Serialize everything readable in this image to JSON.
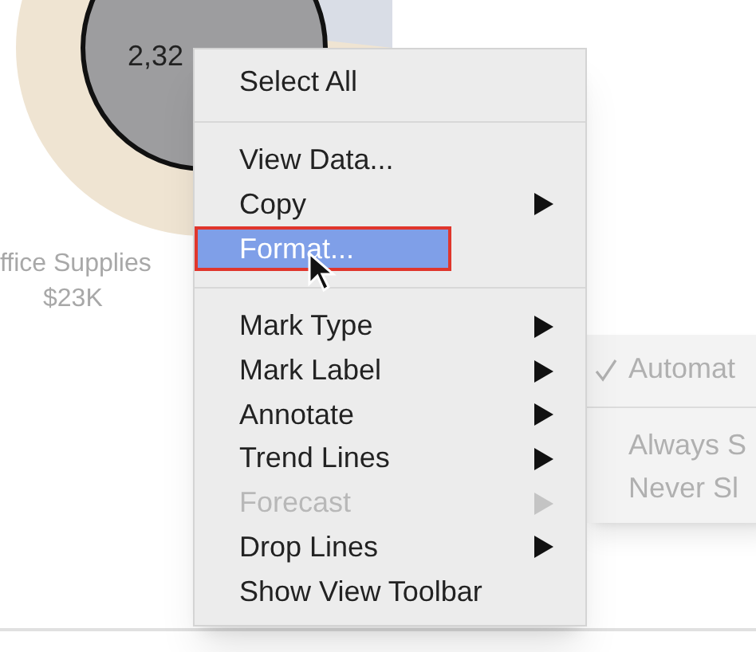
{
  "chart": {
    "center_label": "2,32",
    "segment_label": "ffice Supplies",
    "segment_value": "$23K"
  },
  "context_menu": {
    "items": [
      {
        "kind": "item",
        "label": "Select All",
        "submenu": false,
        "disabled": false,
        "selected": false,
        "outlined": false
      },
      {
        "kind": "separator"
      },
      {
        "kind": "item",
        "label": "View Data...",
        "submenu": false,
        "disabled": false,
        "selected": false,
        "outlined": false
      },
      {
        "kind": "item",
        "label": "Copy",
        "submenu": true,
        "disabled": false,
        "selected": false,
        "outlined": false
      },
      {
        "kind": "item",
        "label": "Format...",
        "submenu": false,
        "disabled": false,
        "selected": true,
        "outlined": true
      },
      {
        "kind": "separator"
      },
      {
        "kind": "item",
        "label": "Mark Type",
        "submenu": true,
        "disabled": false,
        "selected": false,
        "outlined": false
      },
      {
        "kind": "item",
        "label": "Mark Label",
        "submenu": true,
        "disabled": false,
        "selected": false,
        "outlined": false
      },
      {
        "kind": "item",
        "label": "Annotate",
        "submenu": true,
        "disabled": false,
        "selected": false,
        "outlined": false
      },
      {
        "kind": "item",
        "label": "Trend Lines",
        "submenu": true,
        "disabled": false,
        "selected": false,
        "outlined": false
      },
      {
        "kind": "item",
        "label": "Forecast",
        "submenu": true,
        "disabled": true,
        "selected": false,
        "outlined": false
      },
      {
        "kind": "item",
        "label": "Drop Lines",
        "submenu": true,
        "disabled": false,
        "selected": false,
        "outlined": false
      },
      {
        "kind": "item",
        "label": "Show View Toolbar",
        "submenu": false,
        "disabled": false,
        "selected": false,
        "outlined": false
      }
    ]
  },
  "submenu": {
    "items": [
      {
        "kind": "item",
        "label": "Automat",
        "checked": true
      },
      {
        "kind": "separator"
      },
      {
        "kind": "item",
        "label": "Always S",
        "checked": false
      },
      {
        "kind": "item",
        "label": "Never Sl",
        "checked": false
      }
    ]
  }
}
